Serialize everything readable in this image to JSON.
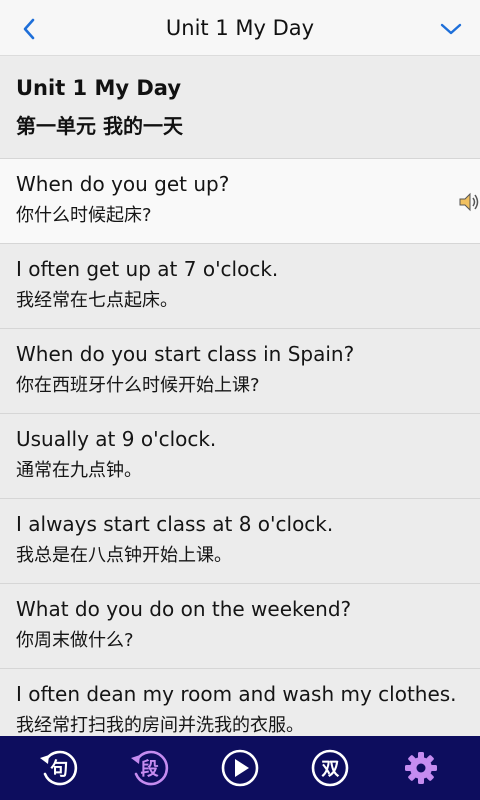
{
  "header": {
    "title": "Unit 1 My Day"
  },
  "lesson": {
    "title_en": "Unit 1 My Day",
    "title_zh": "第一单元 我的一天"
  },
  "sentences": [
    {
      "en": "When do you get up?",
      "zh": "你什么时候起床?",
      "active": true
    },
    {
      "en": "I often get up at 7 o'clock.",
      "zh": "我经常在七点起床。"
    },
    {
      "en": "When do you start class in Spain?",
      "zh": "你在西班牙什么时候开始上课?"
    },
    {
      "en": "Usually at 9 o'clock.",
      "zh": "通常在九点钟。"
    },
    {
      "en": "I always start class at 8 o'clock.",
      "zh": "我总是在八点钟开始上课。"
    },
    {
      "en": "What do you do on the weekend?",
      "zh": "你周末做什么?"
    },
    {
      "en": "I often dean my room and wash my clothes.",
      "zh": "我经常打扫我的房间并洗我的衣服。"
    }
  ],
  "toolbar": {
    "sentence_glyph": "句",
    "paragraph_glyph": "段",
    "dual_glyph": "双"
  },
  "icons": {
    "back": "chevron-left-icon",
    "down": "chevron-down-icon",
    "speaker": "speaker-icon",
    "sentence": "sentence-repeat-icon",
    "paragraph": "paragraph-repeat-icon",
    "play": "play-icon",
    "dual": "bilingual-icon",
    "settings": "gear-icon"
  },
  "colors": {
    "accent": "#1e6fd9",
    "bottom_bar": "#0d0d5e",
    "paragraph_active": "#c58cf0",
    "settings": "#c58cf0"
  }
}
